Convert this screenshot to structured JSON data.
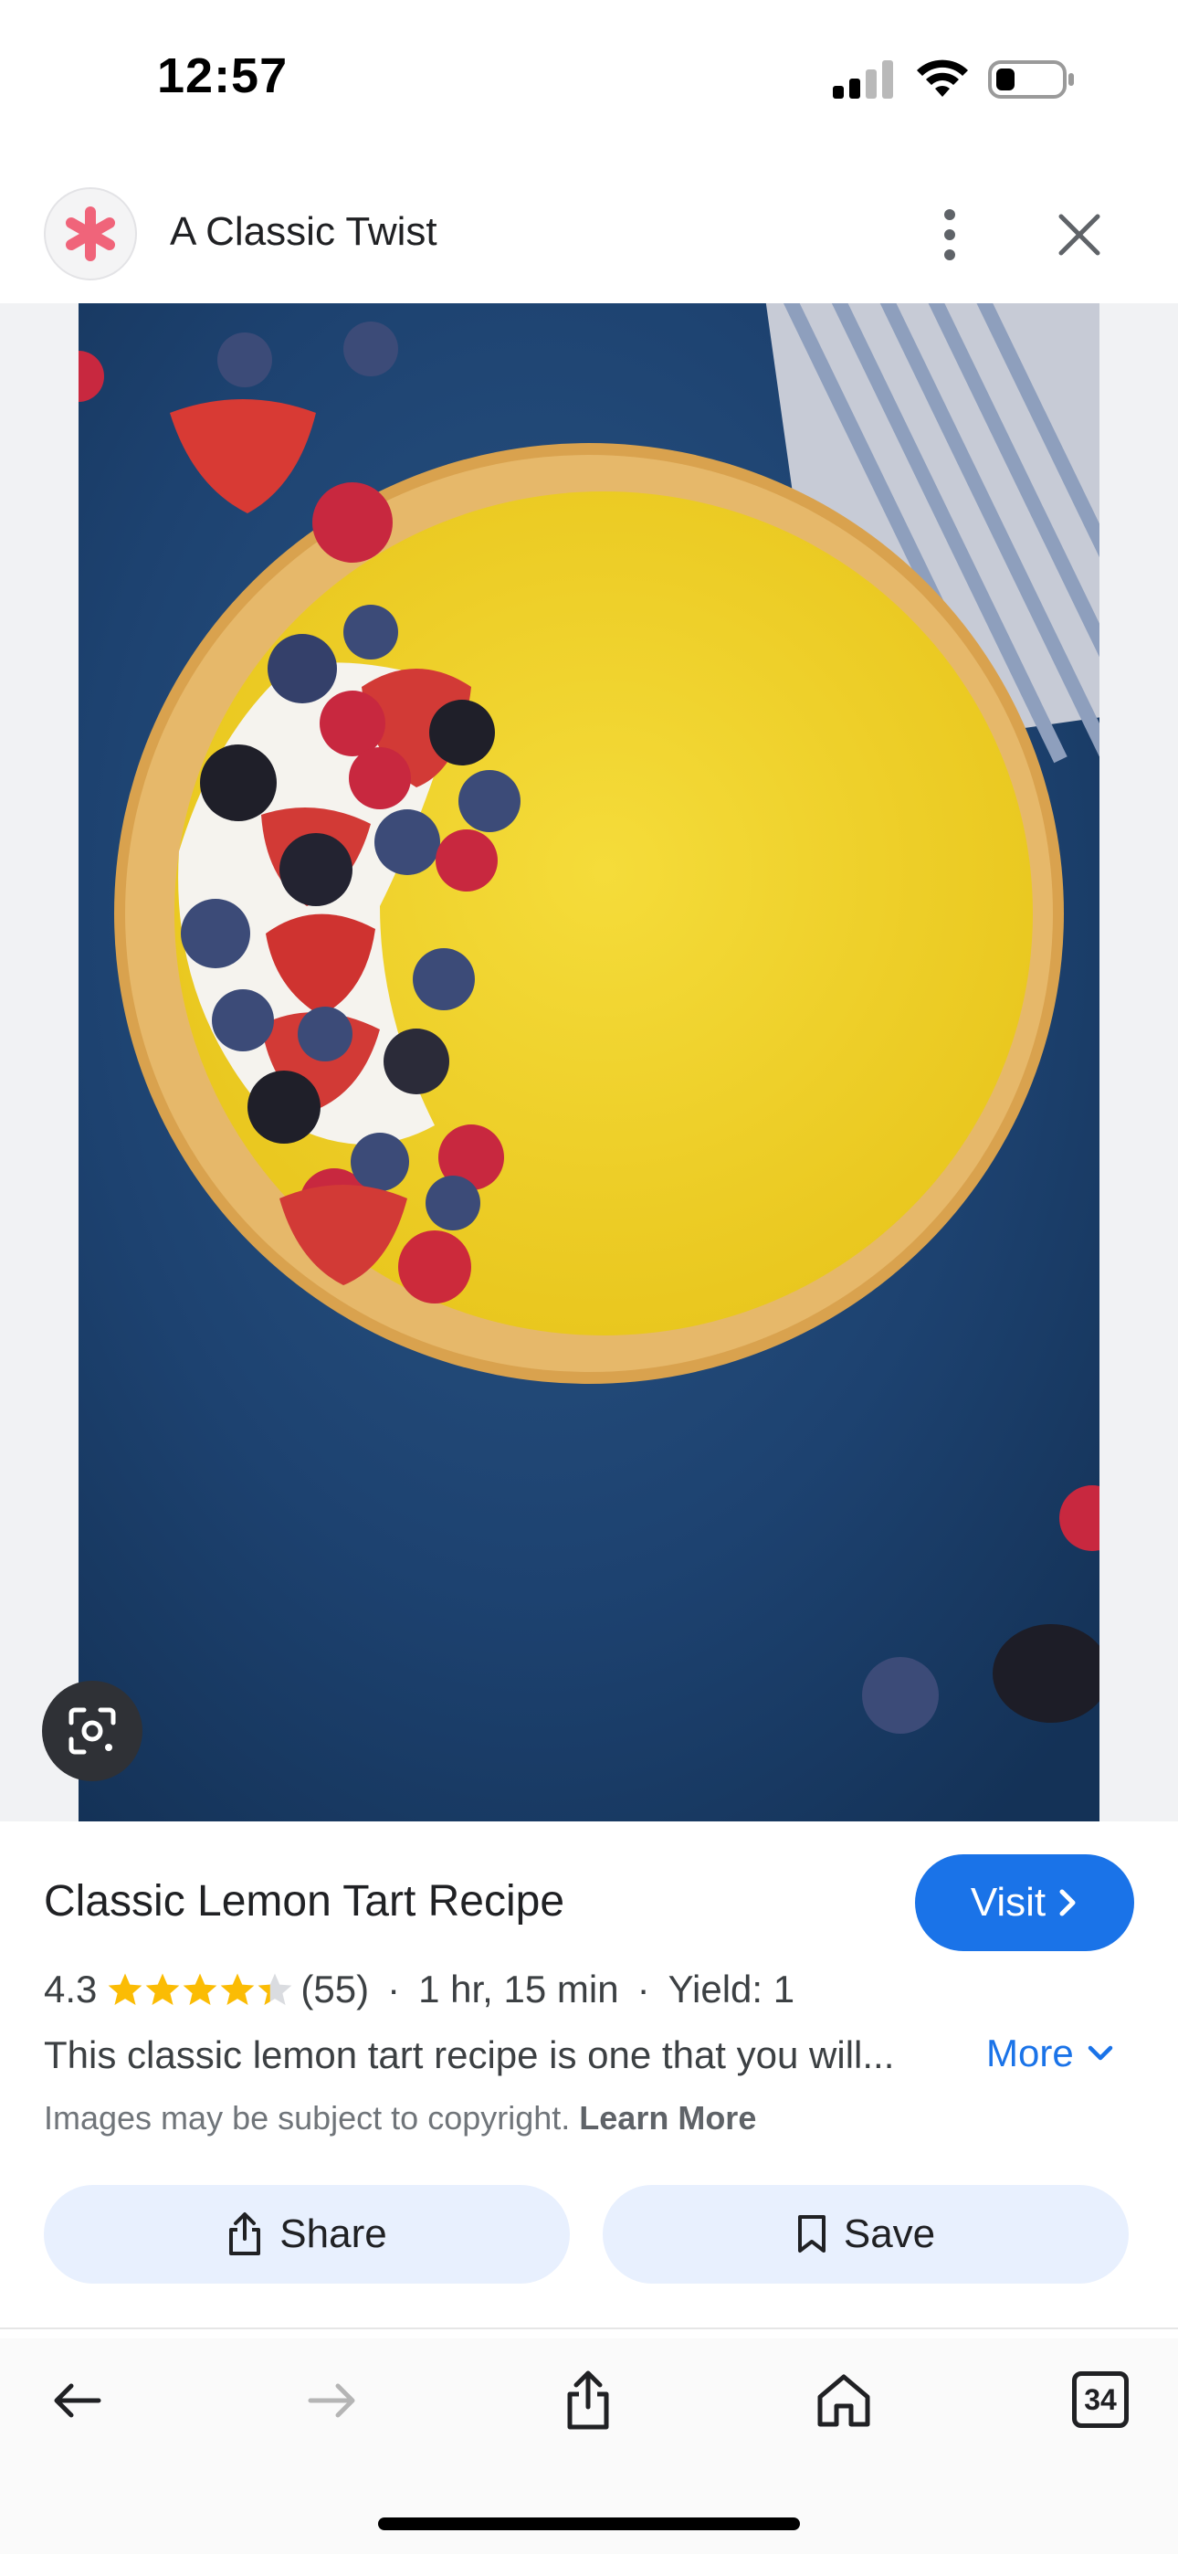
{
  "status_bar": {
    "time": "12:57",
    "icons": [
      "cellular-signal-icon",
      "wifi-icon",
      "battery-icon"
    ]
  },
  "header": {
    "site_name": "A Classic Twist",
    "logo_icon": "asterisk-logo-icon",
    "menu_icon": "more-vert-icon",
    "close_icon": "close-icon"
  },
  "image": {
    "alt": "Lemon tart with berries",
    "lens_icon": "google-lens-icon"
  },
  "result": {
    "title": "Classic Lemon Tart Recipe",
    "visit_label": "Visit",
    "rating": "4.3",
    "rating_value": 4.3,
    "rating_max": 5,
    "reviews": "(55)",
    "time": "1 hr, 15 min",
    "yield": "Yield: 1",
    "separator": "·",
    "description": "This classic lemon tart recipe is one that you will...",
    "more_label": "More",
    "copyright_text": "Images may be subject to copyright.",
    "learn_more": "Learn More",
    "share_label": "Share",
    "save_label": "Save"
  },
  "toolbar": {
    "items": [
      "back-icon",
      "forward-icon",
      "share-icon",
      "home-icon",
      "tabs-icon"
    ],
    "tabs_count": "34"
  },
  "colors": {
    "accent": "#1a73e8",
    "button_bg": "#e8f0fe",
    "star": "#fbbc04",
    "star_empty": "#dadce0",
    "logo": "#f0647a"
  }
}
